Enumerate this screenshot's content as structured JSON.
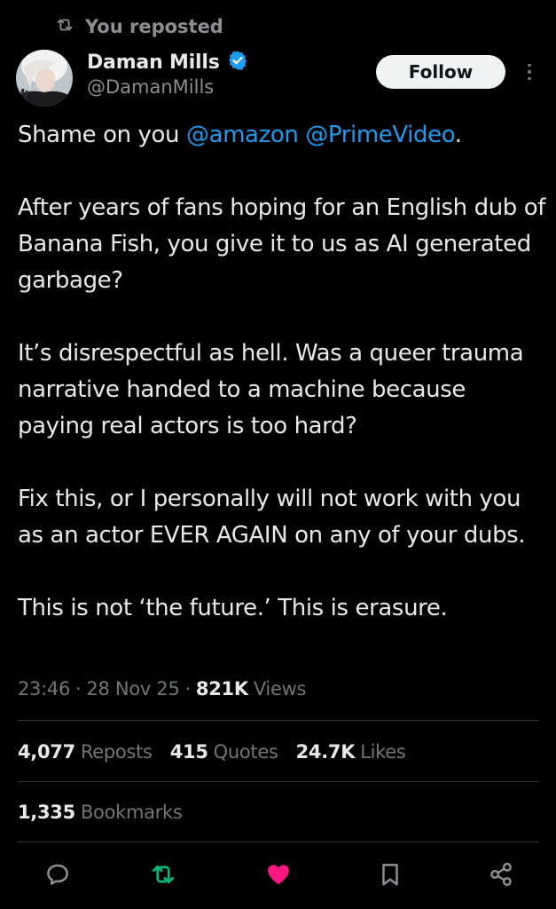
{
  "social_context": {
    "text": "You reposted"
  },
  "author": {
    "name": "Daman Mills",
    "handle": "@DamanMills",
    "verified": true
  },
  "follow_button": {
    "label": "Follow"
  },
  "tweet": {
    "line1_prefix": "Shame on you ",
    "mention1": "@amazon",
    "mention2": "@PrimeVideo",
    "line1_suffix": ".",
    "para2": "After years of fans hoping for an English dub of Banana Fish, you give it to us as AI generated garbage?",
    "para3": "It’s disrespectful as hell. Was a queer trauma narrative handed to a machine because paying real actors is too hard?",
    "para4": "Fix this, or I personally will not work with you as an actor EVER AGAIN on any of your dubs.",
    "para5": "This is not ‘the future.’ This is erasure."
  },
  "meta": {
    "time": "23:46",
    "date": "28 Nov 25",
    "views_count": "821K",
    "views_label": "Views",
    "separator": "·"
  },
  "stats": {
    "reposts_count": "4,077",
    "reposts_label": "Reposts",
    "quotes_count": "415",
    "quotes_label": "Quotes",
    "likes_count": "24.7K",
    "likes_label": "Likes",
    "bookmarks_count": "1,335",
    "bookmarks_label": "Bookmarks"
  },
  "colors": {
    "background": "#000000",
    "text": "#e7e9ea",
    "secondary": "#71767b",
    "mention": "#1d9bf0",
    "verified": "#1d9bf0",
    "repost_active": "#00ba7c",
    "like_active": "#f91880"
  },
  "icons": {
    "social_context": "repost-icon",
    "actions": [
      "reply-icon",
      "repost-icon",
      "like-icon",
      "bookmark-icon",
      "share-icon"
    ]
  }
}
